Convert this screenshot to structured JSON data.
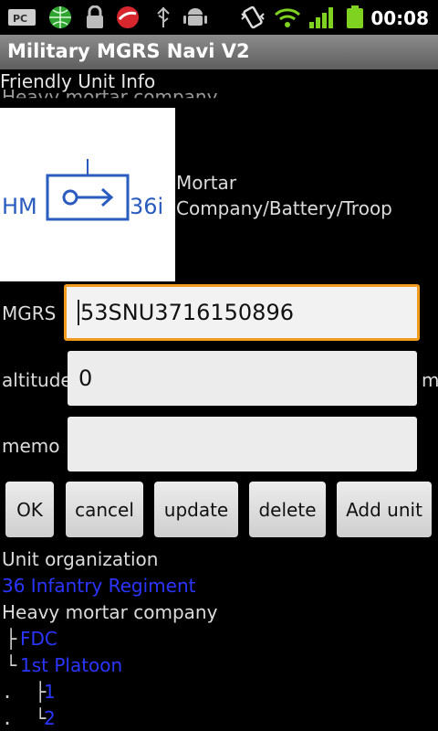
{
  "status_bar": {
    "icons": [
      "pc-icon",
      "globe-icon",
      "lock-icon",
      "trend-icon",
      "usb-icon",
      "android-icon",
      "vibrate-icon",
      "wifi-icon",
      "signal-icon",
      "battery-icon"
    ],
    "time": "00:08"
  },
  "app": {
    "title": "Military MGRS Navi V2"
  },
  "section": {
    "header": "Friendly Unit Info",
    "ghost_text": "Heavy mortar company"
  },
  "symbol": {
    "left_label": "HM",
    "right_label": "36i"
  },
  "unit": {
    "description": "Mortar Company/Battery/Troop"
  },
  "form": {
    "mgrs_label": "MGRS",
    "mgrs_value": "53SNU3716150896",
    "altitude_label": "altitude",
    "altitude_value": "0",
    "altitude_unit": "m",
    "memo_label": "memo",
    "memo_value": ""
  },
  "buttons": {
    "ok": "OK",
    "cancel": "cancel",
    "update": "update",
    "delete": "delete",
    "add_unit": "Add unit"
  },
  "org": {
    "title": "Unit organization",
    "regiment": "36 Infantry Regiment",
    "company": "Heavy mortar company",
    "fdc": "FDC",
    "platoon": "1st Platoon",
    "sub1": "1",
    "sub2": "2"
  },
  "colors": {
    "link": "#2a36ff",
    "focus": "#f29c1f",
    "symbol_blue": "#2a5bbf"
  }
}
